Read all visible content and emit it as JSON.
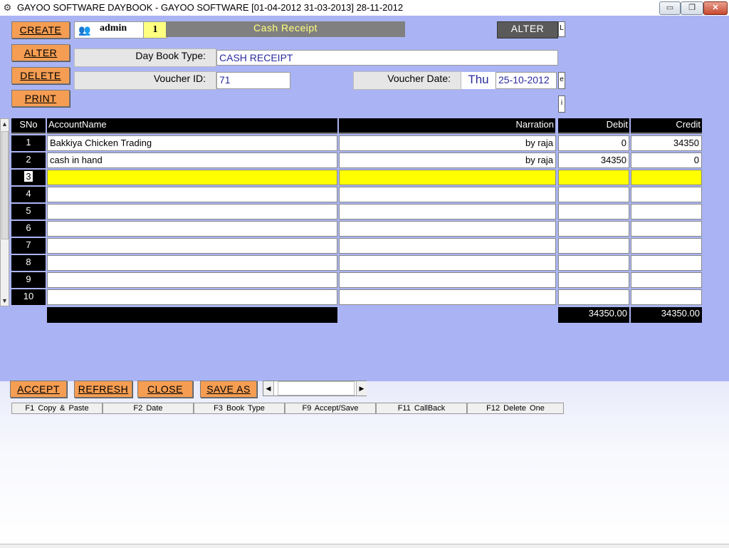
{
  "window": {
    "title": "GAYOO SOFTWARE DAYBOOK - GAYOO SOFTWARE [01-04-2012 31-03-2013] 28-11-2012",
    "minimize_label": "▭",
    "maximize_label": "❐",
    "close_label": "✕"
  },
  "left_buttons": {
    "create": "CREATE",
    "alter": "ALTER",
    "delete": "DELETE",
    "print": "PRINT"
  },
  "header": {
    "user": "admin",
    "company_number": "1",
    "screen_title": "Cash Receipt",
    "alter_label": "ALTER",
    "alter_side": "L"
  },
  "form": {
    "daybook_type_label": "Day Book Type:",
    "daybook_type_value": "CASH RECEIPT",
    "voucher_id_label": "Voucher ID:",
    "voucher_id_value": "71",
    "voucher_date_label": "Voucher Date:",
    "voucher_day": "Thu",
    "voucher_date_value": "25-10-2012",
    "date_side": "e",
    "info_side": "i"
  },
  "grid": {
    "columns": [
      "SNo",
      "AccountName",
      "Narration",
      "Debit",
      "Credit"
    ],
    "rows": [
      {
        "sno": "1",
        "account": "Bakkiya Chicken Trading",
        "narration": "by raja",
        "debit": "0",
        "credit": "34350"
      },
      {
        "sno": "2",
        "account": "cash in hand",
        "narration": "by raja",
        "debit": "34350",
        "credit": "0"
      },
      {
        "sno": "3",
        "account": "",
        "narration": "",
        "debit": "",
        "credit": ""
      },
      {
        "sno": "4",
        "account": "",
        "narration": "",
        "debit": "",
        "credit": ""
      },
      {
        "sno": "5",
        "account": "",
        "narration": "",
        "debit": "",
        "credit": ""
      },
      {
        "sno": "6",
        "account": "",
        "narration": "",
        "debit": "",
        "credit": ""
      },
      {
        "sno": "7",
        "account": "",
        "narration": "",
        "debit": "",
        "credit": ""
      },
      {
        "sno": "8",
        "account": "",
        "narration": "",
        "debit": "",
        "credit": ""
      },
      {
        "sno": "9",
        "account": "",
        "narration": "",
        "debit": "",
        "credit": ""
      },
      {
        "sno": "10",
        "account": "",
        "narration": "",
        "debit": "",
        "credit": ""
      }
    ],
    "selected_row": 3,
    "total_debit": "34350.00",
    "total_credit": "34350.00"
  },
  "bottom_buttons": {
    "accept": "ACCEPT",
    "refresh": "REFRESH",
    "close": "CLOSE",
    "save_as": "SAVE AS"
  },
  "function_keys": [
    "F1 Copy & Paste",
    "F2 Date",
    "F3 Book Type",
    "F9 Accept/Save",
    "F11 CallBack",
    "F12 Delete One"
  ],
  "icons": {
    "app": "gear-icon",
    "user": "users-icon",
    "scroll_up": "arrow-up-icon",
    "scroll_down": "arrow-down-icon",
    "scroll_left": "arrow-left-icon",
    "scroll_right": "arrow-right-icon"
  },
  "colors": {
    "form_background": "#aab4f4",
    "button_orange": "#f59d52",
    "selected_row": "#ffff00",
    "header_black": "#000000",
    "title_yellow": "#ffff80"
  }
}
